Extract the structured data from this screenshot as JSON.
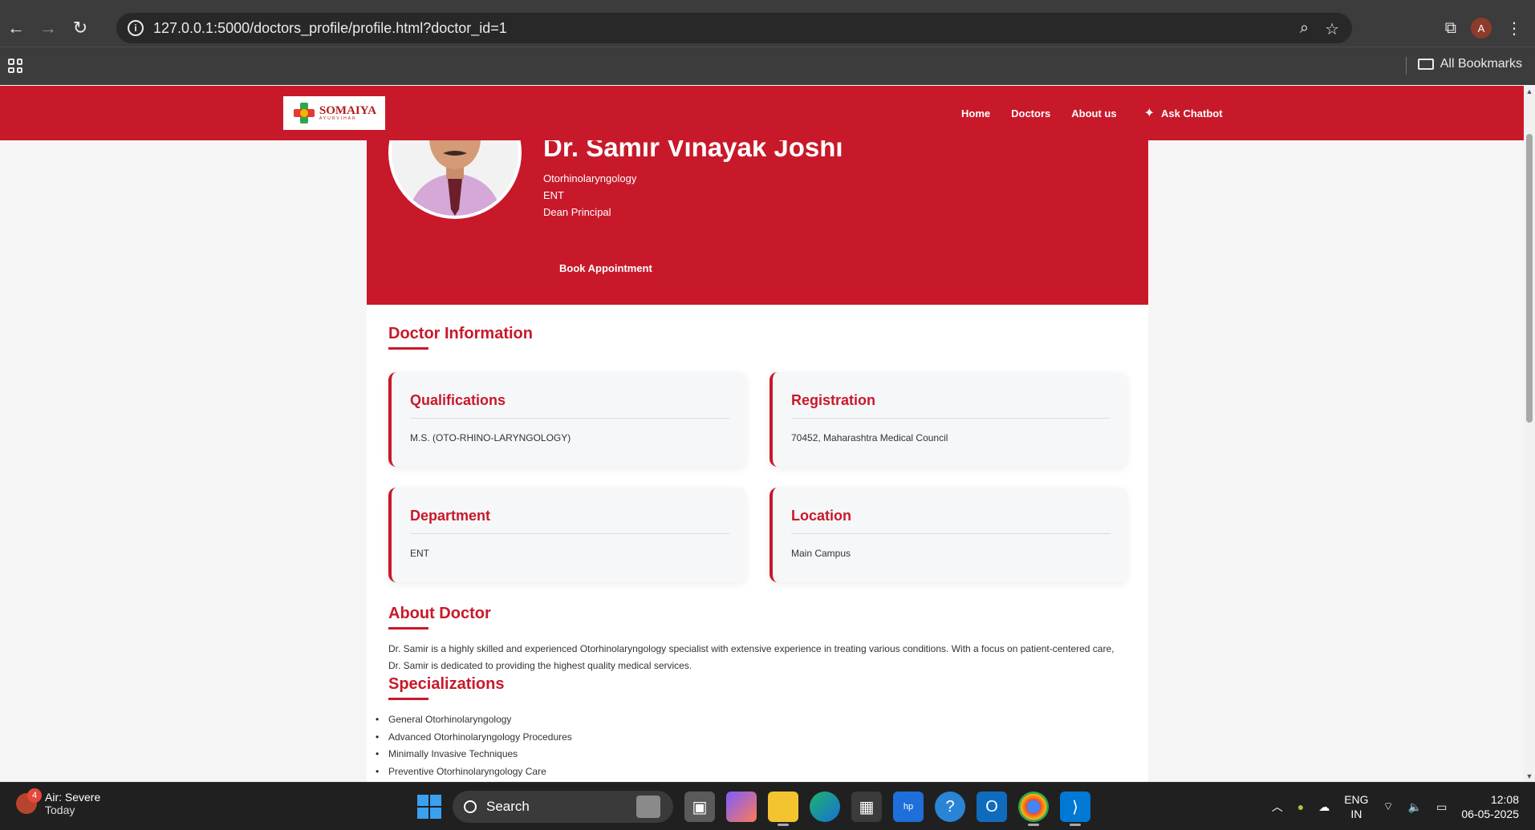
{
  "browser": {
    "url": "127.0.0.1:5000/doctors_profile/profile.html?doctor_id=1",
    "profile_initial": "A",
    "all_bookmarks": "All Bookmarks"
  },
  "site": {
    "logo_text": "SOMAIYA",
    "logo_sub": "AYURVIHAR",
    "nav": {
      "home": "Home",
      "doctors": "Doctors",
      "about": "About us",
      "chatbot": "Ask Chatbot"
    }
  },
  "doctor": {
    "name": "Dr. Samir Vinayak Joshi",
    "specialty": "Otorhinolaryngology",
    "department_short": "ENT",
    "designation": "Dean Principal",
    "book_button": "Book Appointment"
  },
  "info": {
    "title": "Doctor Information",
    "qualifications": {
      "label": "Qualifications",
      "value": "M.S. (OTO-RHINO-LARYNGOLOGY)"
    },
    "registration": {
      "label": "Registration",
      "value": "70452, Maharashtra Medical Council"
    },
    "department": {
      "label": "Department",
      "value": "ENT"
    },
    "location": {
      "label": "Location",
      "value": "Main Campus"
    }
  },
  "about": {
    "title": "About Doctor",
    "text": "Dr. Samir is a highly skilled and experienced Otorhinolaryngology specialist with extensive experience in treating various conditions. With a focus on patient-centered care, Dr. Samir is dedicated to providing the highest quality medical services."
  },
  "specializations": {
    "title": "Specializations",
    "items": [
      "General Otorhinolaryngology",
      "Advanced Otorhinolaryngology Procedures",
      "Minimally Invasive Techniques",
      "Preventive Otorhinolaryngology Care"
    ]
  },
  "taskbar": {
    "weather_badge": "4",
    "weather_title": "Air: Severe",
    "weather_sub": "Today",
    "search": "Search",
    "lang_1": "ENG",
    "lang_2": "IN",
    "time": "12:08",
    "date": "06-05-2025"
  },
  "colors": {
    "brand_red": "#c8192a",
    "browser_dark": "#3c3c3c"
  }
}
